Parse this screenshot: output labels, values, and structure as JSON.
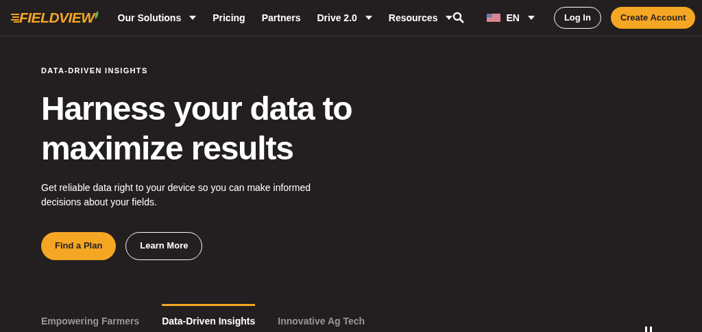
{
  "header": {
    "logo": "FIELDVIEW",
    "nav": [
      {
        "label": "Our Solutions",
        "dropdown": true
      },
      {
        "label": "Pricing",
        "dropdown": false
      },
      {
        "label": "Partners",
        "dropdown": false
      },
      {
        "label": "Drive 2.0",
        "dropdown": true
      },
      {
        "label": "Resources",
        "dropdown": true
      }
    ],
    "language": "EN",
    "login": "Log In",
    "create_account": "Create Account"
  },
  "hero": {
    "eyebrow": "DATA-DRIVEN INSIGHTS",
    "title": "Harness your data to maximize results",
    "body": "Get reliable data right to your device so you can make informed decisions about your fields.",
    "buttons": [
      {
        "label": "Find a Plan",
        "kind": "primary"
      },
      {
        "label": "Learn More",
        "kind": "outline"
      }
    ]
  },
  "tabs": [
    {
      "label": "Empowering Farmers",
      "selected": false
    },
    {
      "label": "Data-Driven Insights",
      "selected": true
    },
    {
      "label": "Innovative Ag Tech",
      "selected": false
    }
  ]
}
